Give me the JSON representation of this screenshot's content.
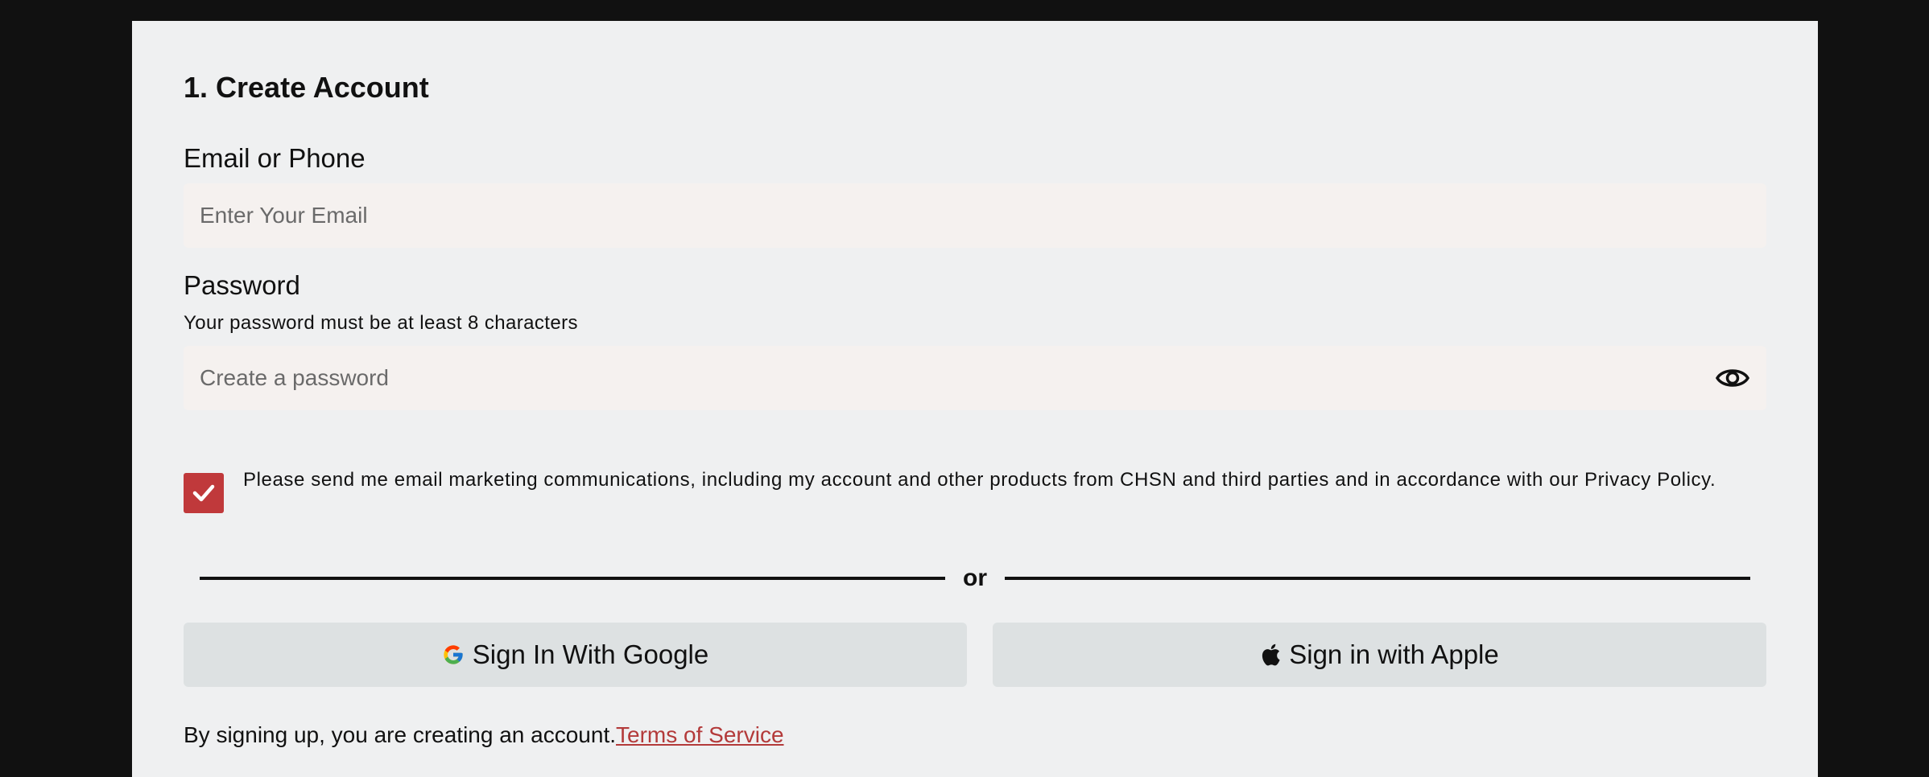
{
  "form": {
    "title": "1. Create Account",
    "email_label": "Email or Phone",
    "email_placeholder": "Enter Your Email",
    "email_value": "",
    "password_label": "Password",
    "password_hint": "Your password must be at least 8 characters",
    "password_placeholder": "Create a password",
    "password_value": "",
    "password_toggle_icon": "eye-icon",
    "consent_checked": true,
    "consent_text": "Please send me email marketing communications, including my account and other products from CHSN and third parties and in accordance with our Privacy Policy.",
    "divider_text": "or",
    "google_button": "Sign In With Google",
    "apple_button": "Sign in with Apple",
    "footer_text": "By signing up, you are creating an account.",
    "terms_link": "Terms of Service"
  },
  "colors": {
    "background": "#111111",
    "panel": "#eff0f1",
    "input_bg": "#f5f1ef",
    "accent_red": "#c0393b",
    "social_button_bg": "#dde1e2",
    "link": "#b33a3a"
  },
  "icons": {
    "checkbox": "checkmark-icon",
    "google": "google-logo-icon",
    "apple": "apple-logo-icon"
  }
}
